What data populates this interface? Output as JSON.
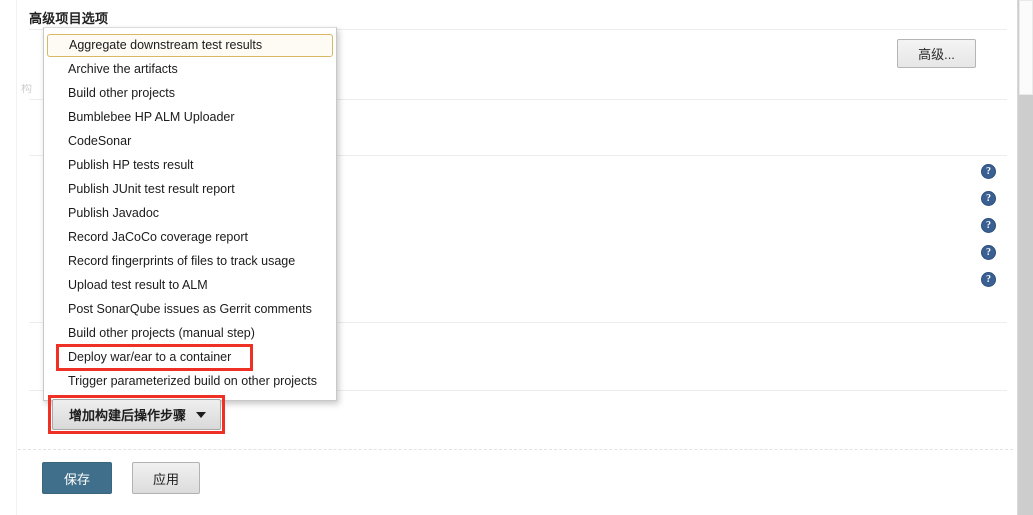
{
  "page": {
    "title": "高级项目选项"
  },
  "advanced_button": {
    "label": "高级..."
  },
  "ghost_label": {
    "text": "构"
  },
  "help_icons": {
    "glyph": "?",
    "count": 5,
    "color": "#3a6093"
  },
  "dropdown": {
    "name": "post-build-action-menu",
    "selected_index": 0,
    "highlight_border_color": "#d8b765",
    "items": [
      {
        "label": "Aggregate downstream test results",
        "selected": true
      },
      {
        "label": "Archive the artifacts",
        "selected": false
      },
      {
        "label": "Build other projects",
        "selected": false
      },
      {
        "label": "Bumblebee HP ALM Uploader",
        "selected": false
      },
      {
        "label": "CodeSonar",
        "selected": false
      },
      {
        "label": "Publish HP tests result",
        "selected": false
      },
      {
        "label": "Publish JUnit test result report",
        "selected": false
      },
      {
        "label": "Publish Javadoc",
        "selected": false
      },
      {
        "label": "Record JaCoCo coverage report",
        "selected": false
      },
      {
        "label": "Record fingerprints of files to track usage",
        "selected": false
      },
      {
        "label": "Upload test result to ALM",
        "selected": false
      },
      {
        "label": "Post SonarQube issues as Gerrit comments",
        "selected": false
      },
      {
        "label": "Build other projects (manual step)",
        "selected": false
      },
      {
        "label": "Deploy war/ear to a container",
        "selected": false
      },
      {
        "label": "Trigger parameterized build on other projects",
        "selected": false
      }
    ]
  },
  "add_step_button": {
    "label": "增加构建后操作步骤",
    "caret": "chevron-down-icon"
  },
  "footer": {
    "save_label": "保存",
    "apply_label": "应用"
  },
  "annotations": {
    "color": "#ee3124",
    "boxes": [
      {
        "target": "Deploy war/ear to a container"
      },
      {
        "target": "增加构建后操作步骤"
      }
    ]
  },
  "scrollbar": {
    "orientation": "vertical",
    "thumb_position": "top"
  }
}
